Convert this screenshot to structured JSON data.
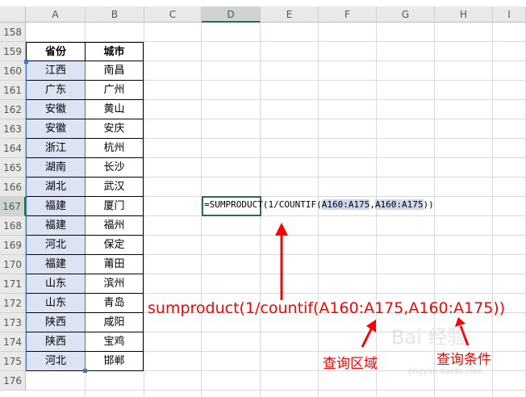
{
  "columns": [
    "A",
    "B",
    "C",
    "D",
    "E",
    "F",
    "G",
    "H",
    "I"
  ],
  "selected_column": "D",
  "rows": [
    "158",
    "159",
    "160",
    "161",
    "162",
    "163",
    "164",
    "165",
    "166",
    "167",
    "168",
    "169",
    "170",
    "171",
    "172",
    "173",
    "174",
    "175",
    "176"
  ],
  "selected_row": "167",
  "table": {
    "headers": [
      "省份",
      "城市"
    ],
    "records": [
      [
        "江西",
        "南昌"
      ],
      [
        "广东",
        "广州"
      ],
      [
        "安徽",
        "黄山"
      ],
      [
        "安徽",
        "安庆"
      ],
      [
        "浙江",
        "杭州"
      ],
      [
        "湖南",
        "长沙"
      ],
      [
        "湖北",
        "武汉"
      ],
      [
        "福建",
        "厦门"
      ],
      [
        "福建",
        "福州"
      ],
      [
        "河北",
        "保定"
      ],
      [
        "福建",
        "莆田"
      ],
      [
        "山东",
        "滨州"
      ],
      [
        "山东",
        "青岛"
      ],
      [
        "陕西",
        "咸阳"
      ],
      [
        "陕西",
        "宝鸡"
      ],
      [
        "河北",
        "邯郸"
      ]
    ]
  },
  "formula": {
    "prefix": "=SUMPRODUCT(1/COUNTIF(",
    "ref1": "A160:A175",
    "sep": ",",
    "ref2": "A160:A175",
    "suffix": "))"
  },
  "annotations": {
    "formula": "sumproduct(1/countif(A160:A175,A160:A175))",
    "range_label": "查询区域",
    "criteria_label": "查询条件"
  },
  "watermark": {
    "text": "Bai 经验",
    "url": "jingyan.baidu.com"
  },
  "colors": {
    "accent": "#217346",
    "range": "#4472c4",
    "annotation": "#ff0000"
  }
}
